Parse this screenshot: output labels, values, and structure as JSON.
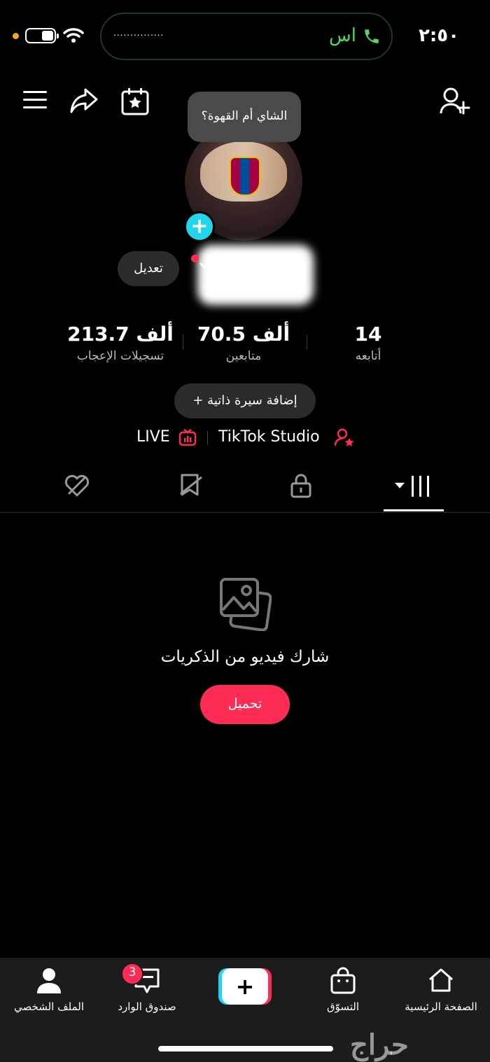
{
  "status_bar": {
    "time": "٢:٥٠",
    "call_label": "اس",
    "pill_dots": "..............."
  },
  "bubble": {
    "text": "الشاي أم القهوة؟"
  },
  "profile": {
    "edit_label": "تعديل",
    "stats": {
      "likes_value": "213.7 ألف",
      "likes_label": "تسجيلات الإعجاب",
      "followers_value": "70.5 ألف",
      "followers_label": "متابعين",
      "following_value": "14",
      "following_label": "أتابعه"
    },
    "bio_button": "+ إضافة سيرة ذاتية",
    "links": {
      "live": "LIVE",
      "studio": "TikTok Studio"
    }
  },
  "tabs": [
    {
      "icon": "grid-icon",
      "active": true
    },
    {
      "icon": "lock-icon",
      "active": false
    },
    {
      "icon": "bookmark-icon",
      "active": false
    },
    {
      "icon": "liked-icon",
      "active": false
    }
  ],
  "empty_state": {
    "title": "شارك فيديو من الذكريات",
    "button": "تحميل"
  },
  "bottom_nav": {
    "home": "الصفحة الرئيسية",
    "shop": "التسوّق",
    "inbox": "صندوق الوارد",
    "inbox_badge": "3",
    "profile": "الملف الشخصي"
  },
  "watermark": "حراج",
  "colors": {
    "accent": "#fe2c55",
    "cyan": "#20d5ec",
    "call_green": "#4cd964"
  }
}
